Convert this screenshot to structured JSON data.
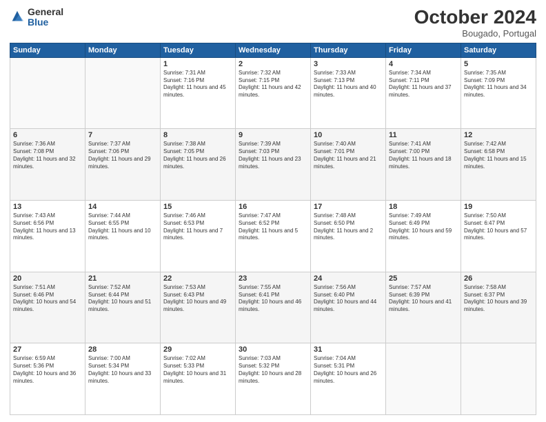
{
  "header": {
    "logo_general": "General",
    "logo_blue": "Blue",
    "month_title": "October 2024",
    "location": "Bougado, Portugal"
  },
  "weekdays": [
    "Sunday",
    "Monday",
    "Tuesday",
    "Wednesday",
    "Thursday",
    "Friday",
    "Saturday"
  ],
  "weeks": [
    [
      {
        "day": "",
        "sunrise": "",
        "sunset": "",
        "daylight": ""
      },
      {
        "day": "",
        "sunrise": "",
        "sunset": "",
        "daylight": ""
      },
      {
        "day": "1",
        "sunrise": "Sunrise: 7:31 AM",
        "sunset": "Sunset: 7:16 PM",
        "daylight": "Daylight: 11 hours and 45 minutes."
      },
      {
        "day": "2",
        "sunrise": "Sunrise: 7:32 AM",
        "sunset": "Sunset: 7:15 PM",
        "daylight": "Daylight: 11 hours and 42 minutes."
      },
      {
        "day": "3",
        "sunrise": "Sunrise: 7:33 AM",
        "sunset": "Sunset: 7:13 PM",
        "daylight": "Daylight: 11 hours and 40 minutes."
      },
      {
        "day": "4",
        "sunrise": "Sunrise: 7:34 AM",
        "sunset": "Sunset: 7:11 PM",
        "daylight": "Daylight: 11 hours and 37 minutes."
      },
      {
        "day": "5",
        "sunrise": "Sunrise: 7:35 AM",
        "sunset": "Sunset: 7:09 PM",
        "daylight": "Daylight: 11 hours and 34 minutes."
      }
    ],
    [
      {
        "day": "6",
        "sunrise": "Sunrise: 7:36 AM",
        "sunset": "Sunset: 7:08 PM",
        "daylight": "Daylight: 11 hours and 32 minutes."
      },
      {
        "day": "7",
        "sunrise": "Sunrise: 7:37 AM",
        "sunset": "Sunset: 7:06 PM",
        "daylight": "Daylight: 11 hours and 29 minutes."
      },
      {
        "day": "8",
        "sunrise": "Sunrise: 7:38 AM",
        "sunset": "Sunset: 7:05 PM",
        "daylight": "Daylight: 11 hours and 26 minutes."
      },
      {
        "day": "9",
        "sunrise": "Sunrise: 7:39 AM",
        "sunset": "Sunset: 7:03 PM",
        "daylight": "Daylight: 11 hours and 23 minutes."
      },
      {
        "day": "10",
        "sunrise": "Sunrise: 7:40 AM",
        "sunset": "Sunset: 7:01 PM",
        "daylight": "Daylight: 11 hours and 21 minutes."
      },
      {
        "day": "11",
        "sunrise": "Sunrise: 7:41 AM",
        "sunset": "Sunset: 7:00 PM",
        "daylight": "Daylight: 11 hours and 18 minutes."
      },
      {
        "day": "12",
        "sunrise": "Sunrise: 7:42 AM",
        "sunset": "Sunset: 6:58 PM",
        "daylight": "Daylight: 11 hours and 15 minutes."
      }
    ],
    [
      {
        "day": "13",
        "sunrise": "Sunrise: 7:43 AM",
        "sunset": "Sunset: 6:56 PM",
        "daylight": "Daylight: 11 hours and 13 minutes."
      },
      {
        "day": "14",
        "sunrise": "Sunrise: 7:44 AM",
        "sunset": "Sunset: 6:55 PM",
        "daylight": "Daylight: 11 hours and 10 minutes."
      },
      {
        "day": "15",
        "sunrise": "Sunrise: 7:46 AM",
        "sunset": "Sunset: 6:53 PM",
        "daylight": "Daylight: 11 hours and 7 minutes."
      },
      {
        "day": "16",
        "sunrise": "Sunrise: 7:47 AM",
        "sunset": "Sunset: 6:52 PM",
        "daylight": "Daylight: 11 hours and 5 minutes."
      },
      {
        "day": "17",
        "sunrise": "Sunrise: 7:48 AM",
        "sunset": "Sunset: 6:50 PM",
        "daylight": "Daylight: 11 hours and 2 minutes."
      },
      {
        "day": "18",
        "sunrise": "Sunrise: 7:49 AM",
        "sunset": "Sunset: 6:49 PM",
        "daylight": "Daylight: 10 hours and 59 minutes."
      },
      {
        "day": "19",
        "sunrise": "Sunrise: 7:50 AM",
        "sunset": "Sunset: 6:47 PM",
        "daylight": "Daylight: 10 hours and 57 minutes."
      }
    ],
    [
      {
        "day": "20",
        "sunrise": "Sunrise: 7:51 AM",
        "sunset": "Sunset: 6:46 PM",
        "daylight": "Daylight: 10 hours and 54 minutes."
      },
      {
        "day": "21",
        "sunrise": "Sunrise: 7:52 AM",
        "sunset": "Sunset: 6:44 PM",
        "daylight": "Daylight: 10 hours and 51 minutes."
      },
      {
        "day": "22",
        "sunrise": "Sunrise: 7:53 AM",
        "sunset": "Sunset: 6:43 PM",
        "daylight": "Daylight: 10 hours and 49 minutes."
      },
      {
        "day": "23",
        "sunrise": "Sunrise: 7:55 AM",
        "sunset": "Sunset: 6:41 PM",
        "daylight": "Daylight: 10 hours and 46 minutes."
      },
      {
        "day": "24",
        "sunrise": "Sunrise: 7:56 AM",
        "sunset": "Sunset: 6:40 PM",
        "daylight": "Daylight: 10 hours and 44 minutes."
      },
      {
        "day": "25",
        "sunrise": "Sunrise: 7:57 AM",
        "sunset": "Sunset: 6:39 PM",
        "daylight": "Daylight: 10 hours and 41 minutes."
      },
      {
        "day": "26",
        "sunrise": "Sunrise: 7:58 AM",
        "sunset": "Sunset: 6:37 PM",
        "daylight": "Daylight: 10 hours and 39 minutes."
      }
    ],
    [
      {
        "day": "27",
        "sunrise": "Sunrise: 6:59 AM",
        "sunset": "Sunset: 5:36 PM",
        "daylight": "Daylight: 10 hours and 36 minutes."
      },
      {
        "day": "28",
        "sunrise": "Sunrise: 7:00 AM",
        "sunset": "Sunset: 5:34 PM",
        "daylight": "Daylight: 10 hours and 33 minutes."
      },
      {
        "day": "29",
        "sunrise": "Sunrise: 7:02 AM",
        "sunset": "Sunset: 5:33 PM",
        "daylight": "Daylight: 10 hours and 31 minutes."
      },
      {
        "day": "30",
        "sunrise": "Sunrise: 7:03 AM",
        "sunset": "Sunset: 5:32 PM",
        "daylight": "Daylight: 10 hours and 28 minutes."
      },
      {
        "day": "31",
        "sunrise": "Sunrise: 7:04 AM",
        "sunset": "Sunset: 5:31 PM",
        "daylight": "Daylight: 10 hours and 26 minutes."
      },
      {
        "day": "",
        "sunrise": "",
        "sunset": "",
        "daylight": ""
      },
      {
        "day": "",
        "sunrise": "",
        "sunset": "",
        "daylight": ""
      }
    ]
  ]
}
